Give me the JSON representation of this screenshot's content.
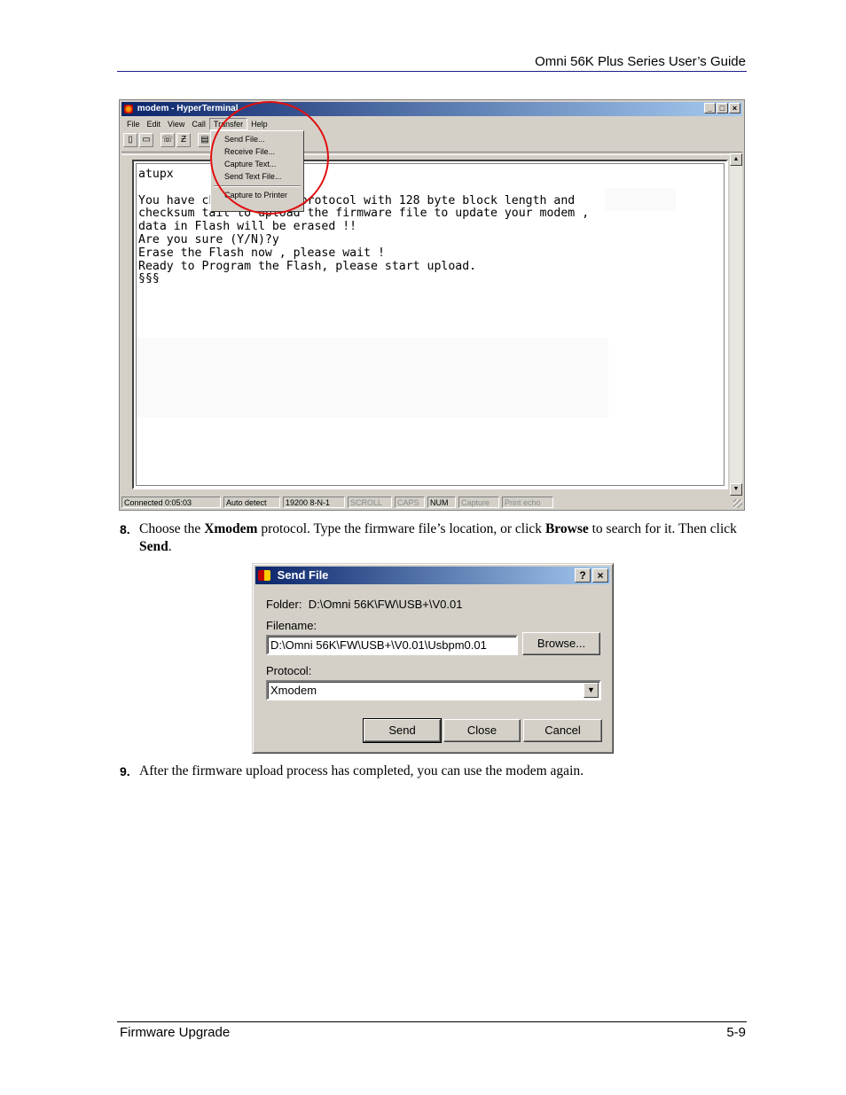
{
  "header": {
    "title": "Omni 56K Plus Series User’s Guide"
  },
  "footer": {
    "section": "Firmware Upgrade",
    "page": "5-9"
  },
  "hyperterminal": {
    "title": "modem - HyperTerminal",
    "menu": [
      "File",
      "Edit",
      "View",
      "Call",
      "Transfer",
      "Help"
    ],
    "toolbar_icons": [
      "new-icon",
      "open-icon",
      "connect-icon",
      "disconnect-icon",
      "properties-icon"
    ],
    "transfer_menu": [
      "Send File...",
      "Receive File...",
      "Capture Text...",
      "Send Text File...",
      "Capture to Printer"
    ],
    "terminal_lines": [
      "atupx",
      "",
      "You have chosen Xmodem protocol with 128 byte block length and",
      "checksum tail to upload the firmware file to update your modem ,",
      "data in Flash will be erased !!",
      "Are you sure (Y/N)?y",
      "Erase the Flash now , please wait !",
      "Ready to Program the Flash, please start upload.",
      "§§§"
    ],
    "status": {
      "connected": "Connected 0:05:03",
      "detect": "Auto detect",
      "settings": "19200 8-N-1",
      "scroll": "SCROLL",
      "caps": "CAPS",
      "num": "NUM",
      "capture": "Capture",
      "print_echo": "Print echo"
    }
  },
  "steps": {
    "s8": {
      "num": "8.",
      "t1": "Choose the ",
      "b1": "Xmodem",
      "t2": " protocol. Type the firmware file’s location, or click ",
      "b2": "Browse",
      "t3": " to search for it. Then click ",
      "b3": "Send",
      "t4": "."
    },
    "s9": {
      "num": "9.",
      "text": "After the firmware upload process has completed, you can use the modem again."
    }
  },
  "send_file": {
    "title": "Send File",
    "folder_label": "Folder:",
    "folder_value": "D:\\Omni 56K\\FW\\USB+\\V0.01",
    "filename_label": "Filename:",
    "filename_value": "D:\\Omni 56K\\FW\\USB+\\V0.01\\Usbpm0.01",
    "browse_label": "Browse...",
    "protocol_label": "Protocol:",
    "protocol_value": "Xmodem",
    "send_label": "Send",
    "close_label": "Close",
    "cancel_label": "Cancel"
  },
  "colors": {
    "titlebar_start": "#0a246a",
    "titlebar_end": "#a6caf0",
    "highlight_ring": "#e01010",
    "header_rule": "#1c1c8c"
  }
}
